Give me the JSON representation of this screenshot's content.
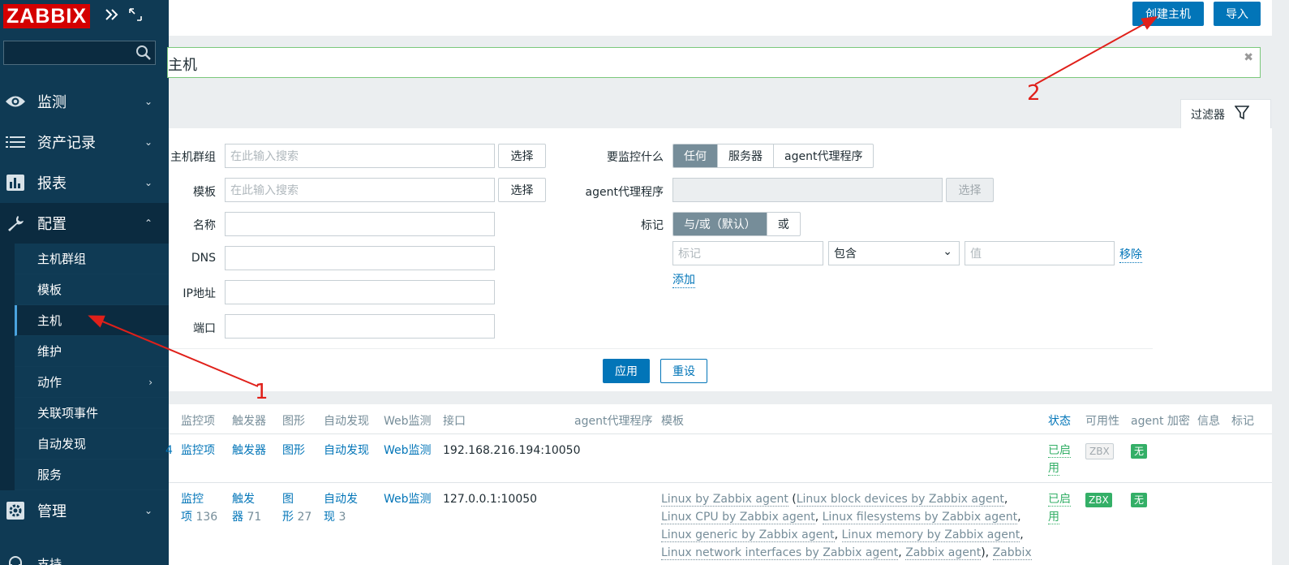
{
  "sidebar": {
    "logo": "ZABBIX",
    "search_placeholder": "",
    "menu": [
      {
        "label": "监测",
        "icon": "eye-icon"
      },
      {
        "label": "资产记录",
        "icon": "list-icon"
      },
      {
        "label": "报表",
        "icon": "bar-chart-icon"
      },
      {
        "label": "配置",
        "icon": "wrench-icon"
      }
    ],
    "submenu": [
      "主机群组",
      "模板",
      "主机",
      "维护",
      "动作",
      "关联项事件",
      "自动发现",
      "服务"
    ],
    "admin": {
      "label": "管理",
      "icon": "gear-icon"
    },
    "support": {
      "label": "支持",
      "icon": "headset-icon"
    }
  },
  "header": {
    "create_host": "创建主机",
    "import": "导入"
  },
  "page_title": "主机",
  "filter": {
    "tab_label": "过滤器",
    "host_groups_label": "主机群组",
    "host_groups_placeholder": "在此输入搜索",
    "templates_label": "模板",
    "templates_placeholder": "在此输入搜索",
    "select": "选择",
    "name_label": "名称",
    "dns_label": "DNS",
    "ip_label": "IP地址",
    "port_label": "端口",
    "monitored_by_label": "要监控什么",
    "monitored_by_options": [
      "任何",
      "服务器",
      "agent代理程序"
    ],
    "proxy_label": "agent代理程序",
    "tags_label": "标记",
    "tags_options": [
      "与/或（默认）",
      "或"
    ],
    "tag_placeholder": "标记",
    "tag_operator": "包含",
    "value_placeholder": "值",
    "remove": "移除",
    "add": "添加",
    "apply": "应用",
    "reset": "重设"
  },
  "table": {
    "headers": [
      "监控项",
      "触发器",
      "图形",
      "自动发现",
      "Web监测",
      "接口",
      "agent代理程序",
      "模板",
      "状态",
      "可用性",
      "agent 加密",
      "信息",
      "标记"
    ],
    "rows": [
      {
        "prefix": "4",
        "items": "监控项",
        "triggers": "触发器",
        "graphs": "图形",
        "discovery": "自动发现",
        "web": "Web监测",
        "interface": "192.168.216.194:10050",
        "status_line1": "已启",
        "status_line2": "用",
        "availability": "ZBX",
        "encryption": "无"
      },
      {
        "items_line1": "监控",
        "items_line2": "项",
        "items_count": "136",
        "triggers_line1": "触发",
        "triggers_line2": "器",
        "triggers_count": "71",
        "graphs_line1": "图",
        "graphs_line2": "形",
        "graphs_count": "27",
        "discovery_line1": "自动发",
        "discovery_line2": "现",
        "discovery_count": "3",
        "web": "Web监测",
        "interface": "127.0.0.1:10050",
        "templates": [
          "Linux by Zabbix agent",
          "Linux block devices by Zabbix agent",
          "Linux CPU by Zabbix agent",
          "Linux filesystems by Zabbix agent",
          "Linux generic by Zabbix agent",
          "Linux memory by Zabbix agent",
          "Linux network interfaces by Zabbix agent",
          "Zabbix agent",
          "Zabbix server health"
        ],
        "status_line1": "已启",
        "status_line2": "用",
        "availability": "ZBX",
        "encryption": "无"
      }
    ]
  },
  "annotations": [
    "1",
    "2"
  ],
  "colors": {
    "sidebar": "#0f3a54",
    "primary": "#0275b8",
    "logo": "#d40000",
    "annotation": "#e0201a",
    "enabled": "#34af67"
  }
}
